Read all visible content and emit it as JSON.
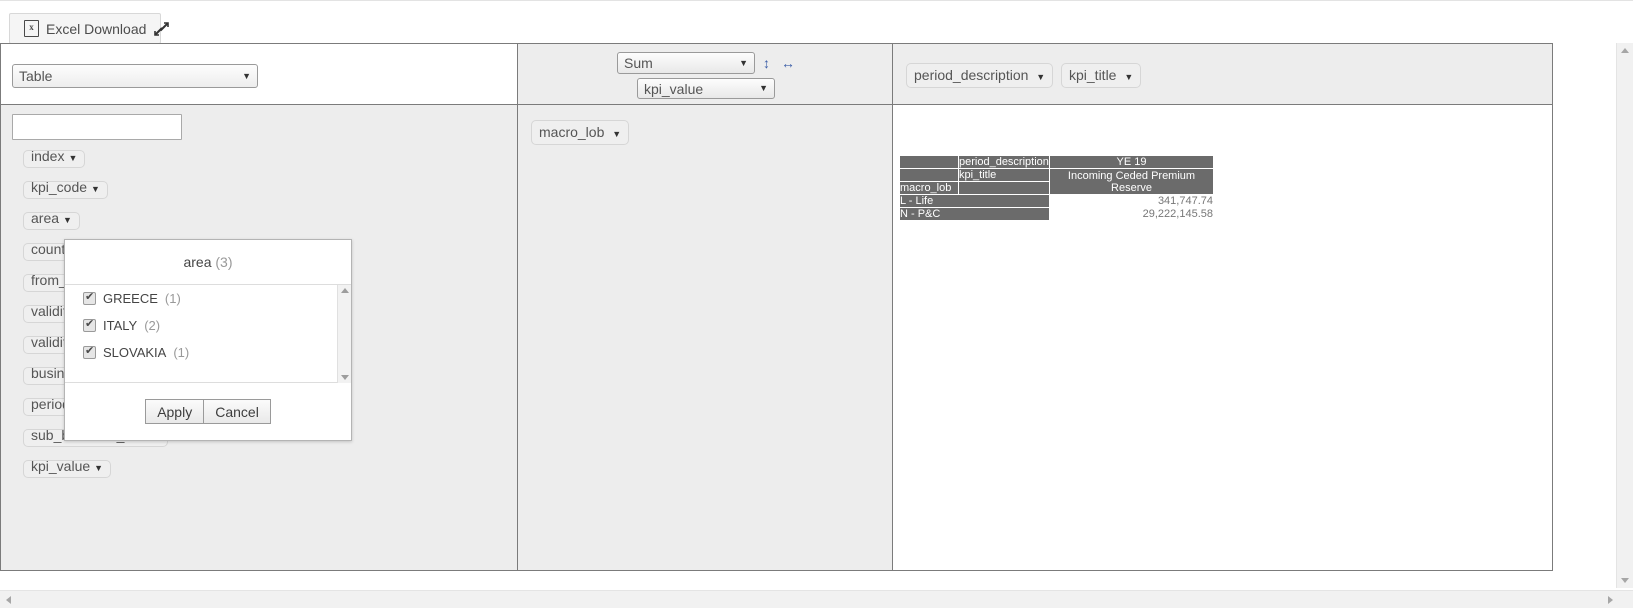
{
  "toolbar": {
    "excel_download_label": "Excel Download",
    "excel_icon_glyph": "x",
    "expand_icon": "expand-arrows-icon"
  },
  "left_panel": {
    "table_select": {
      "value": "Table",
      "caret": "▼"
    },
    "search": {
      "value": "",
      "placeholder": ""
    },
    "fields": [
      {
        "label": "index"
      },
      {
        "label": "kpi_code"
      },
      {
        "label": "area"
      },
      {
        "label": "country"
      },
      {
        "label": "from_validity"
      },
      {
        "label": "validity_from"
      },
      {
        "label": "validity_to"
      },
      {
        "label": "business_unit"
      },
      {
        "label": "period_id"
      },
      {
        "label": "sub_business_unit"
      },
      {
        "label": "kpi_value"
      }
    ],
    "caret": "▼"
  },
  "middle_panel": {
    "aggregator": {
      "value": "Sum",
      "caret": "▼"
    },
    "value_field": {
      "value": "kpi_value",
      "caret": "▼"
    },
    "sort_vertical_icon": "sort-vertical-icon",
    "sort_horizontal_icon": "sort-horizontal-icon",
    "sort_vertical_glyph": "↕",
    "sort_horizontal_glyph": "↔",
    "row_fields": [
      {
        "label": "macro_lob"
      }
    ],
    "caret": "▼"
  },
  "right_panel": {
    "column_fields": [
      {
        "label": "period_description"
      },
      {
        "label": "kpi_title"
      }
    ],
    "caret": "▼",
    "pivot": {
      "col_header_1_label": "period_description",
      "col_header_1_value": "YE 19",
      "col_header_2_label": "kpi_title",
      "col_header_2_value": "Incoming Ceded Premium Reserve",
      "row_header_label": "macro_lob",
      "rows": [
        {
          "label": "L - Life",
          "value": "341,747.74"
        },
        {
          "label": "N - P&C",
          "value": "29,222,145.58"
        }
      ]
    }
  },
  "filter_popup": {
    "title": "area",
    "count": "(3)",
    "items": [
      {
        "label": "GREECE",
        "count": "(1)",
        "checked": true
      },
      {
        "label": "ITALY",
        "count": "(2)",
        "checked": true
      },
      {
        "label": "SLOVAKIA",
        "count": "(1)",
        "checked": true
      }
    ],
    "apply_label": "Apply",
    "cancel_label": "Cancel"
  },
  "colors": {
    "pivot_header_bg": "#6b6b6b",
    "panel_bg": "#ededed",
    "accent_blue": "#3d5fa8"
  }
}
